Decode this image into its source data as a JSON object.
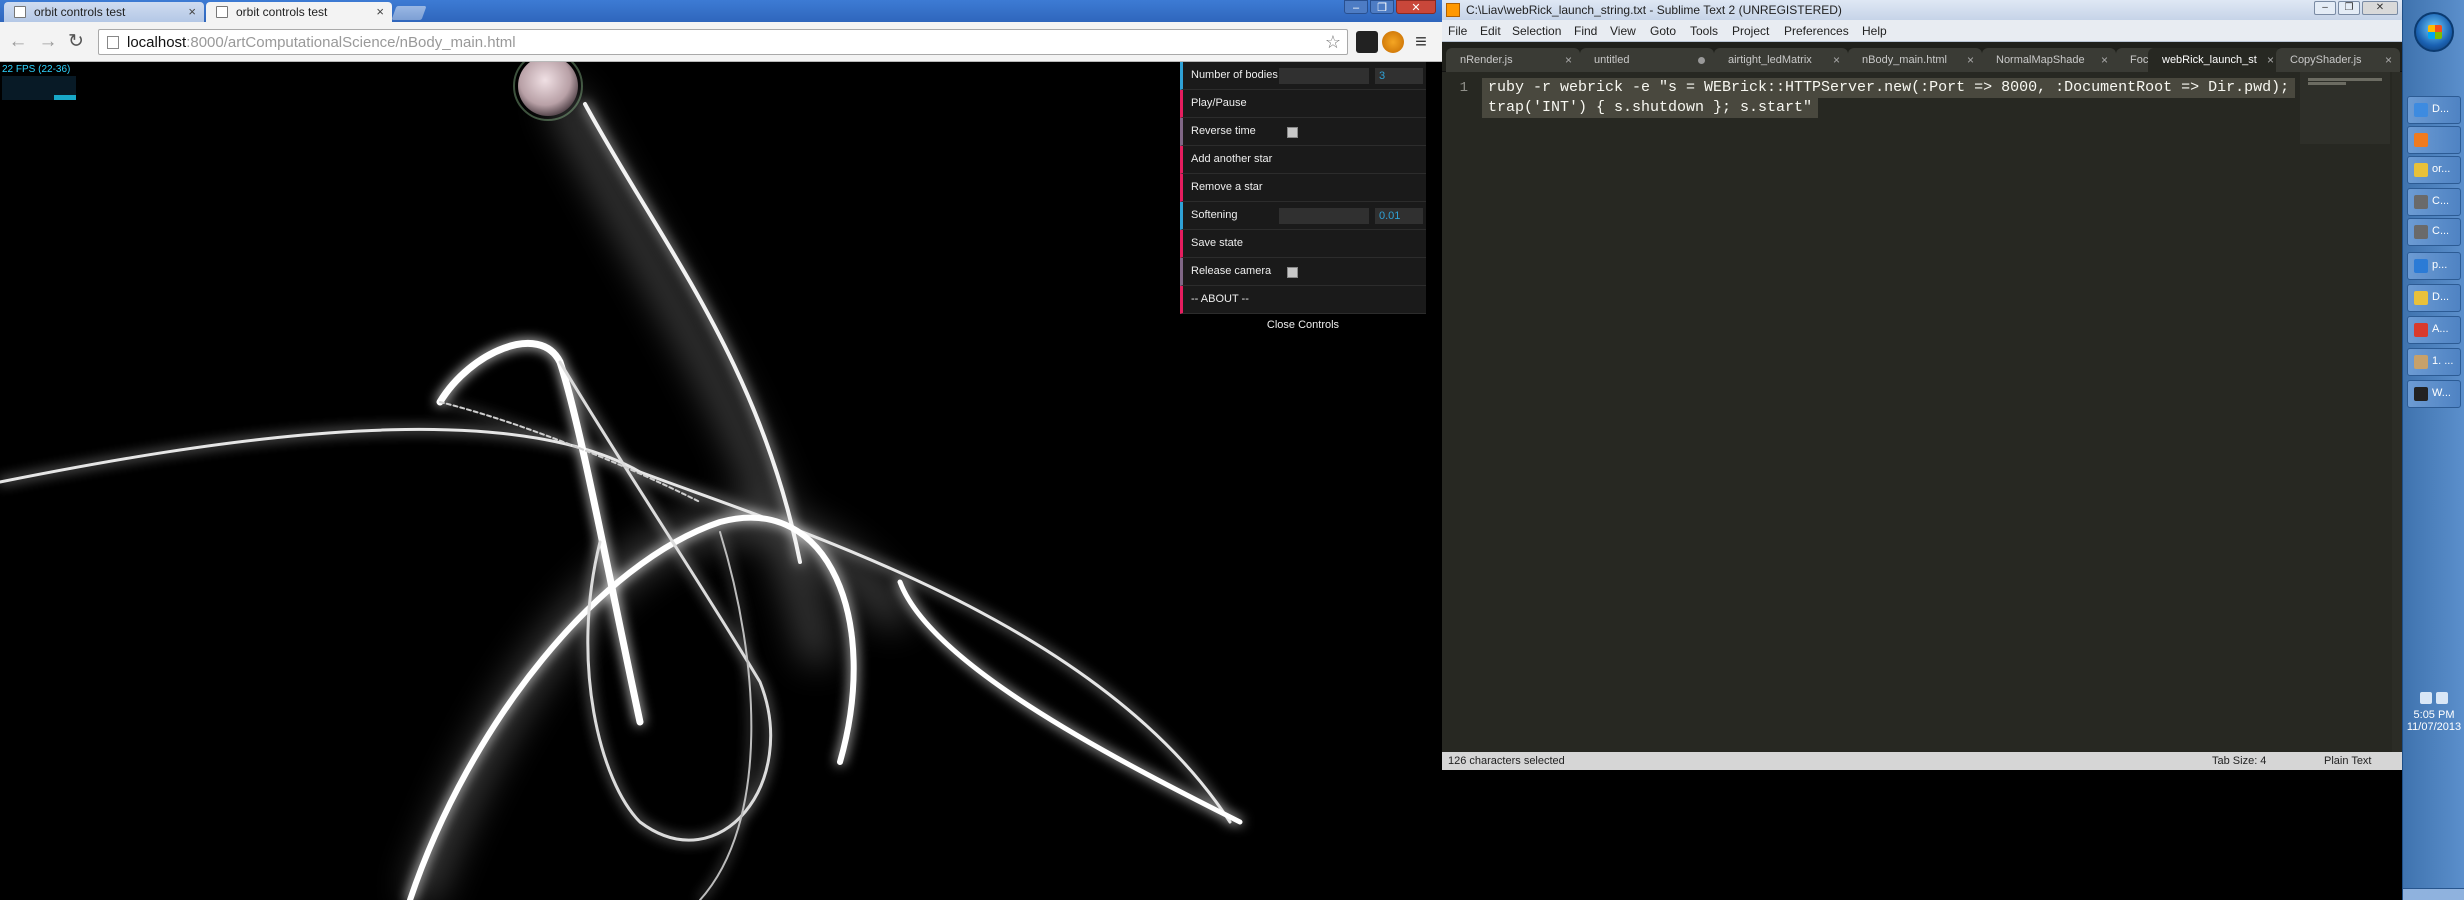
{
  "chrome": {
    "tabs": [
      {
        "title": "orbit controls test",
        "active": false
      },
      {
        "title": "orbit controls test",
        "active": true
      }
    ],
    "url_host": "localhost",
    "url_path": ":8000/artComputationalScience/nBody_main.html",
    "fps_text": "22 FPS (22-36)",
    "gui": {
      "rows": [
        {
          "label": "Number of bodies",
          "kind": "number",
          "value": "3"
        },
        {
          "label": "Play/Pause",
          "kind": "function"
        },
        {
          "label": "Reverse time",
          "kind": "boolean",
          "checked": false
        },
        {
          "label": "Add another star",
          "kind": "function"
        },
        {
          "label": "Remove a star",
          "kind": "function"
        },
        {
          "label": "Softening",
          "kind": "number",
          "value": "0.01"
        },
        {
          "label": "Save state",
          "kind": "function"
        },
        {
          "label": "Release camera",
          "kind": "boolean",
          "checked": false
        },
        {
          "label": "-- ABOUT --",
          "kind": "function"
        }
      ],
      "close_label": "Close Controls"
    }
  },
  "sublime": {
    "title": "C:\\Liav\\webRick_launch_string.txt - Sublime Text 2 (UNREGISTERED)",
    "menu": [
      "File",
      "Edit",
      "Selection",
      "Find",
      "View",
      "Goto",
      "Tools",
      "Project",
      "Preferences",
      "Help"
    ],
    "tabs": [
      {
        "label": "nRender.js",
        "state": "close"
      },
      {
        "label": "untitled",
        "state": "dirty"
      },
      {
        "label": "airtight_ledMatrix",
        "state": "close"
      },
      {
        "label": "nBody_main.html",
        "state": "close"
      },
      {
        "label": "NormalMapShade",
        "state": "close"
      },
      {
        "label": "FocusShader.js",
        "state": "close"
      },
      {
        "label": "webRick_launch_st",
        "state": "close",
        "active": true
      },
      {
        "label": "CopyShader.js",
        "state": "close"
      }
    ],
    "line_number": "1",
    "code_lines": [
      "ruby -r webrick -e \"s = WEBrick::HTTPServer.new(:Port => 8000, :DocumentRoot => Dir.pwd);",
      "trap('INT') { s.shutdown }; s.start\""
    ],
    "status_left": "126 characters selected",
    "status_tab": "Tab Size: 4",
    "status_syntax": "Plain Text"
  },
  "taskbar": {
    "buttons": [
      {
        "label": "D...",
        "color": "#3d8be0"
      },
      {
        "label": "",
        "color": "#f07b1e"
      },
      {
        "label": "or...",
        "color": "#e9c13a"
      },
      {
        "label": "C...",
        "color": "#6a6a6a"
      },
      {
        "label": "C...",
        "color": "#6a6a6a"
      },
      {
        "label": "p...",
        "color": "#2b7bd6"
      },
      {
        "label": "D...",
        "color": "#e9c13a"
      },
      {
        "label": "A...",
        "color": "#d93a2b"
      },
      {
        "label": "1. ...",
        "color": "#c7a16a"
      },
      {
        "label": "W...",
        "color": "#222222"
      }
    ],
    "time": "5:05 PM",
    "date": "11/07/2013"
  }
}
